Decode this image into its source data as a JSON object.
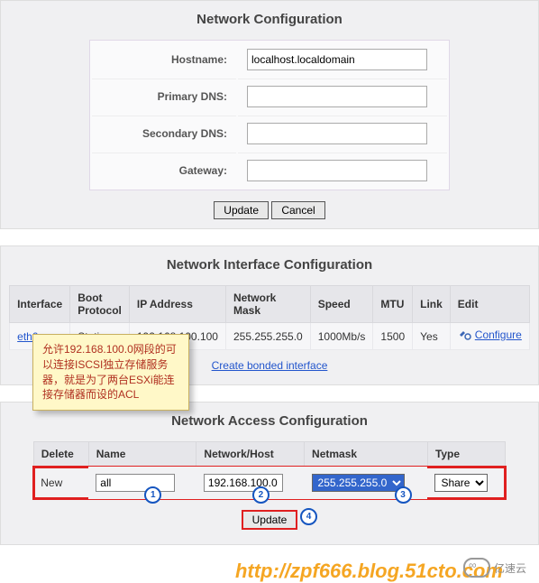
{
  "section1": {
    "title": "Network Configuration",
    "fields": {
      "hostname_label": "Hostname:",
      "hostname_value": "localhost.localdomain",
      "primary_dns_label": "Primary DNS:",
      "primary_dns_value": "",
      "secondary_dns_label": "Secondary DNS:",
      "secondary_dns_value": "",
      "gateway_label": "Gateway:",
      "gateway_value": ""
    },
    "buttons": {
      "update": "Update",
      "cancel": "Cancel"
    }
  },
  "section2": {
    "title": "Network Interface Configuration",
    "headers": {
      "interface": "Interface",
      "boot": "Boot Protocol",
      "ip": "IP Address",
      "mask": "Network Mask",
      "speed": "Speed",
      "mtu": "MTU",
      "link": "Link",
      "edit": "Edit"
    },
    "row": {
      "interface": "eth0",
      "boot": "Static",
      "ip": "192.168.100.100",
      "mask": "255.255.255.0",
      "speed": "1000Mb/s",
      "mtu": "1500",
      "link": "Yes",
      "configure": "Configure"
    },
    "bonded_link": "Create bonded interface"
  },
  "annotation": {
    "text": "允许192.168.100.0网段的可以连接ISCSI独立存储服务器，就是为了两台ESXi能连接存储器而设的ACL"
  },
  "section3": {
    "title": "Network Access Configuration",
    "headers": {
      "delete": "Delete",
      "name": "Name",
      "nethost": "Network/Host",
      "netmask": "Netmask",
      "type": "Type"
    },
    "row": {
      "status": "New",
      "name_value": "all",
      "nethost_value": "192.168.100.0",
      "netmask_value": "255.255.255.0",
      "type_value": "Share"
    },
    "update": "Update",
    "markers": {
      "m1": "1",
      "m2": "2",
      "m3": "3",
      "m4": "4"
    }
  },
  "watermark": {
    "url": "http://zpf666.blog.51cto.com",
    "brand": "亿速云"
  }
}
